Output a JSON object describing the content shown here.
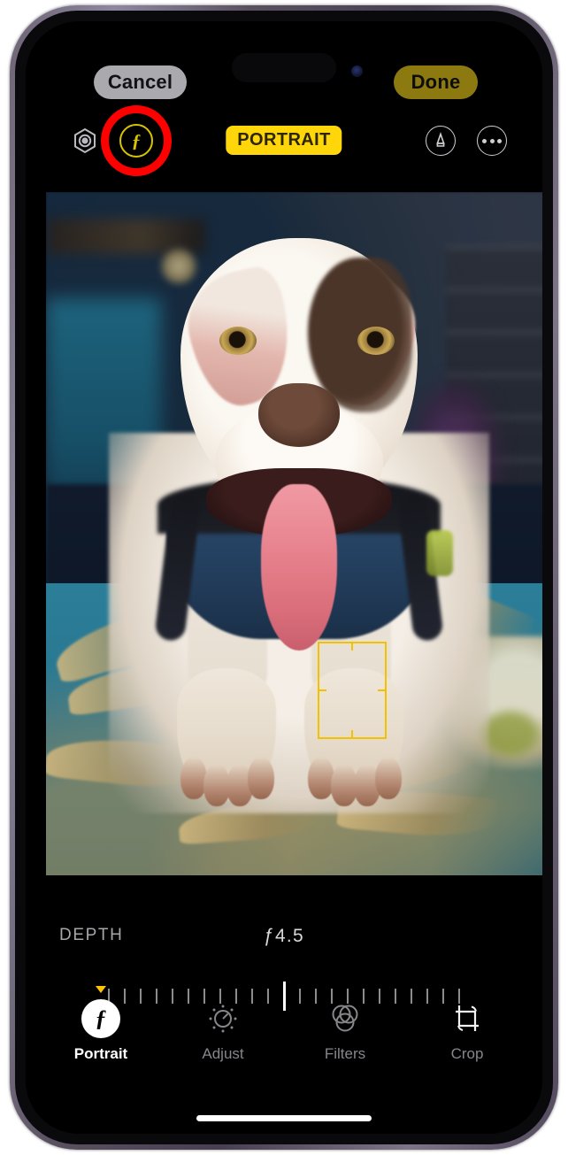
{
  "app": {
    "screen_title": "Photos Portrait Editor",
    "mode_badge": "PORTRAIT"
  },
  "top_actions": {
    "cancel_label": "Cancel",
    "done_label": "Done"
  },
  "tool_row": {
    "live_photo_icon": "live-photo-hexagon-icon",
    "fnumber_label": "ƒ",
    "fnumber_icon": "aperture-f-icon",
    "markup_icon": "markup-pen-icon",
    "more_icon": "more-ellipsis-icon",
    "highlight_color": "#ff0000"
  },
  "photo": {
    "subject": "white pit bull dog with brown eye patch, tongue out, wearing navy blue harness, lying on teal leaf-patterned blanket",
    "focus_rect_color": "#f2c200"
  },
  "depth": {
    "label": "DEPTH",
    "value": "ƒ4.5",
    "value_symbol": "ƒ",
    "value_number": "4.5",
    "tick_count": 23,
    "current_tick_index": 11
  },
  "tabs": [
    {
      "label": "Portrait",
      "icon": "portrait-f-icon",
      "active": true
    },
    {
      "label": "Adjust",
      "icon": "adjust-dial-icon",
      "active": false
    },
    {
      "label": "Filters",
      "icon": "filters-circles-icon",
      "active": false
    },
    {
      "label": "Crop",
      "icon": "crop-rotate-icon",
      "active": false
    }
  ],
  "colors": {
    "accent_yellow": "#ffd60a",
    "done_pill": "#8c7a10",
    "cancel_pill": "#a9a9ae",
    "highlight_red": "#ff0000",
    "focus_yellow": "#f2c200",
    "screen_background": "#000000"
  }
}
